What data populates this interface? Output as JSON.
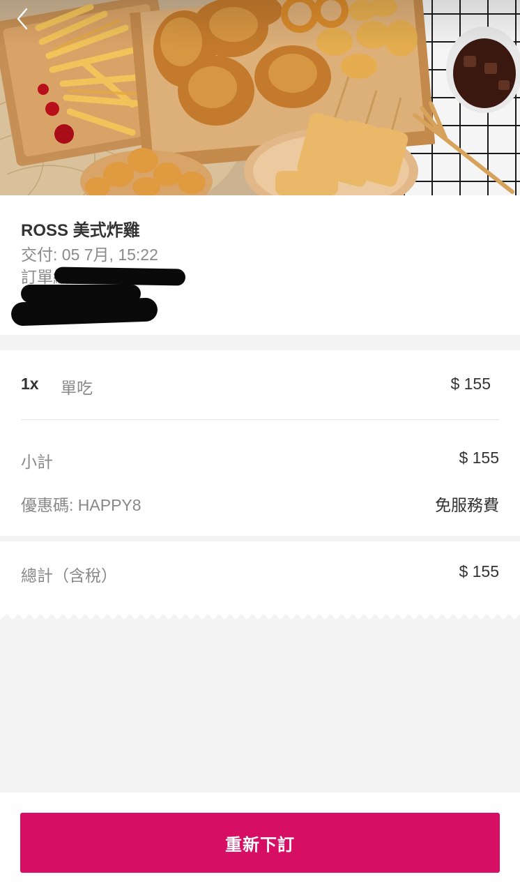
{
  "restaurant": {
    "name": "ROSS 美式炸雞",
    "delivered": "交付: 05 7月, 15:22",
    "order_number_label": "訂單編號"
  },
  "items": [
    {
      "qty": "1x",
      "name": "單吃",
      "price": "$ 155"
    }
  ],
  "summary": {
    "subtotal_label": "小計",
    "subtotal_value": "$ 155",
    "promo_label": "優惠碼: HAPPY8",
    "promo_value": "免服務費",
    "total_label": "總計（含稅）",
    "total_value": "$ 155"
  },
  "actions": {
    "reorder_label": "重新下訂"
  },
  "colors": {
    "accent": "#d70f64",
    "text_primary": "#333333",
    "text_secondary": "#888888",
    "page_bg": "#f4f4f4"
  },
  "icons": {
    "back": "chevron-left-icon"
  }
}
